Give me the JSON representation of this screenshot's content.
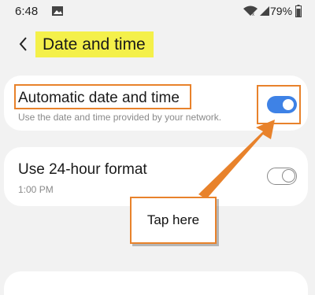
{
  "status_bar": {
    "time": "6:48",
    "battery": "79%",
    "icons": [
      "image-icon",
      "wifi-icon",
      "signal-icon",
      "battery-icon"
    ]
  },
  "header": {
    "title": "Date and time",
    "back_icon": "back-arrow-icon",
    "highlight_color": "#f4f04a"
  },
  "settings": [
    {
      "title": "Automatic date and time",
      "subtitle": "Use the date and time provided by your network.",
      "toggle": "on"
    },
    {
      "title": "Use 24-hour format",
      "subtitle": "1:00 PM",
      "toggle": "off"
    }
  ],
  "annotation": {
    "callout_text": "Tap here",
    "color": "#e8822b"
  },
  "colors": {
    "toggle_on": "#3e82e6",
    "background": "#f2f2f2"
  }
}
